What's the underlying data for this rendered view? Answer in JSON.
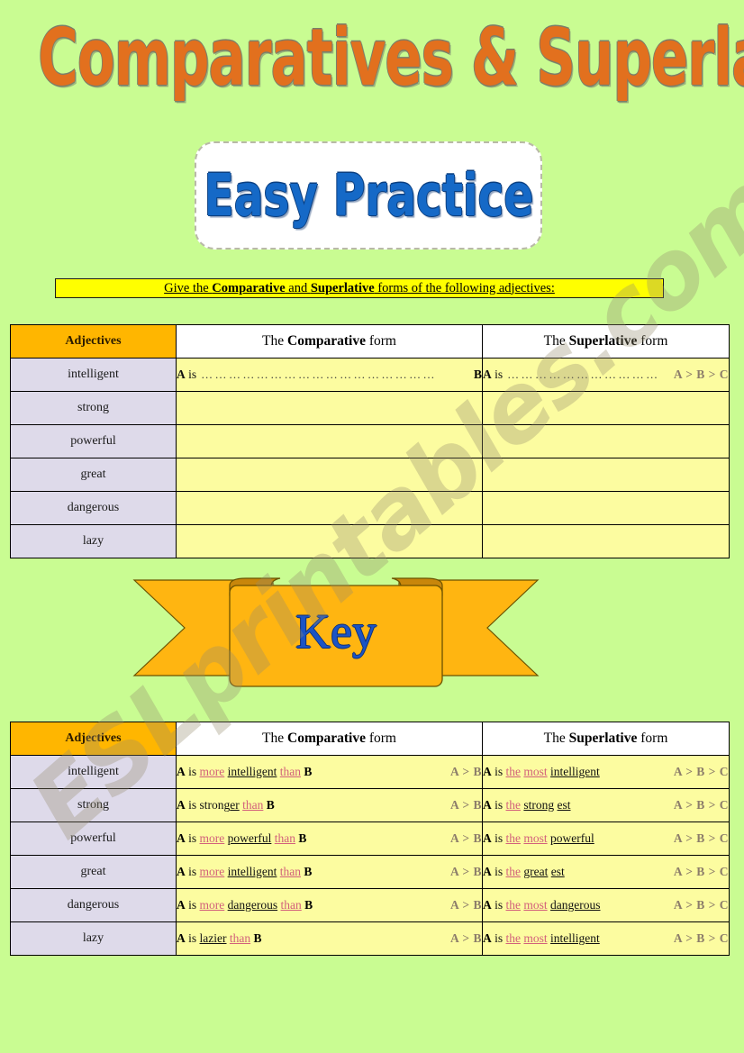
{
  "document": {
    "title": "Comparatives & Superlatives",
    "subtitle": "Easy Practice",
    "background_color": "#C9FC92",
    "watermark": "ESLprintables.com"
  },
  "instruction": {
    "part1": "Give the ",
    "part2": "Comparative",
    "part3": " and ",
    "part4": "Superlative",
    "part5": " forms of the following adjectives:"
  },
  "table_headers": {
    "adjectives": "Adjectives",
    "comparative_pre": "The ",
    "comparative_bold": "Comparative",
    "comparative_post": " form",
    "superlative_pre": "The ",
    "superlative_bold": "Superlative",
    "superlative_post": " form"
  },
  "practice_table": {
    "rows": [
      {
        "adjective": "intelligent",
        "comparative": {
          "lead_a": "A",
          "lead_is": " is ",
          "dots": "……………………………………………",
          "end": "B"
        },
        "superlative": {
          "lead_a": "A",
          "lead_is": " is ",
          "dots": "……………………………",
          "notation": "A > B > C"
        }
      },
      {
        "adjective": "strong",
        "comparative": {},
        "superlative": {}
      },
      {
        "adjective": "powerful",
        "comparative": {},
        "superlative": {}
      },
      {
        "adjective": "great",
        "comparative": {},
        "superlative": {}
      },
      {
        "adjective": "dangerous",
        "comparative": {},
        "superlative": {}
      },
      {
        "adjective": "lazy",
        "comparative": {},
        "superlative": {}
      }
    ]
  },
  "key_banner": {
    "label": "Key",
    "ribbon_color": "#FFB511",
    "ribbon_shadow_color": "#C8860B"
  },
  "key_table": {
    "rows": [
      {
        "adjective": "intelligent",
        "comparative": {
          "a": "A",
          "is": " is ",
          "w1": "more",
          "w2": "intelligent",
          "w3": "than",
          "b": "B",
          "notation": "A > B"
        },
        "superlative": {
          "a": "A",
          "is": " is ",
          "w1": "the",
          "w2": "most",
          "w3": "intelligent",
          "notation": "A > B > C"
        }
      },
      {
        "adjective": "strong",
        "comparative": {
          "a": "A",
          "is": " is  ",
          "w0": "strong",
          "w1": "er",
          "w3": "than",
          "b": "B",
          "notation": "A > B"
        },
        "superlative": {
          "a": "A",
          "is": " is ",
          "w1": "the",
          "w2": "strong",
          "w3": "est",
          "notation": "A > B > C"
        }
      },
      {
        "adjective": "powerful",
        "comparative": {
          "a": "A",
          "is": " is ",
          "w1": "more",
          "w2": "powerful",
          "w3": "than",
          "b": "B",
          "notation": "A > B"
        },
        "superlative": {
          "a": "A",
          "is": " is ",
          "w1": "the",
          "w2": "most",
          "w3": "powerful",
          "notation": "A > B > C"
        }
      },
      {
        "adjective": "great",
        "comparative": {
          "a": "A",
          "is": " is ",
          "w1": "more",
          "w2": "intelligent",
          "w3": "than",
          "b": "B",
          "notation": "A > B"
        },
        "superlative": {
          "a": "A",
          "is": " is ",
          "w1": "the",
          "w2": "great",
          "w3": "est",
          "notation": "A > B > C"
        }
      },
      {
        "adjective": "dangerous",
        "comparative": {
          "a": "A",
          "is": " is ",
          "w1": "more",
          "w2": "dangerous",
          "w3": "than",
          "b": "B",
          "notation": "A > B"
        },
        "superlative": {
          "a": "A",
          "is": " is ",
          "w1": "the",
          "w2": "most",
          "w3": "dangerous",
          "notation": "A > B > C"
        }
      },
      {
        "adjective": "lazy",
        "comparative": {
          "a": "A",
          "is": " is  ",
          "w2": "lazier",
          "w3": "than",
          "b": "B",
          "notation": "A > B"
        },
        "superlative": {
          "a": "A",
          "is": " is ",
          "w1": "the",
          "w2": "most",
          "w3": "intelligent",
          "notation": "A > B > C"
        }
      }
    ]
  }
}
